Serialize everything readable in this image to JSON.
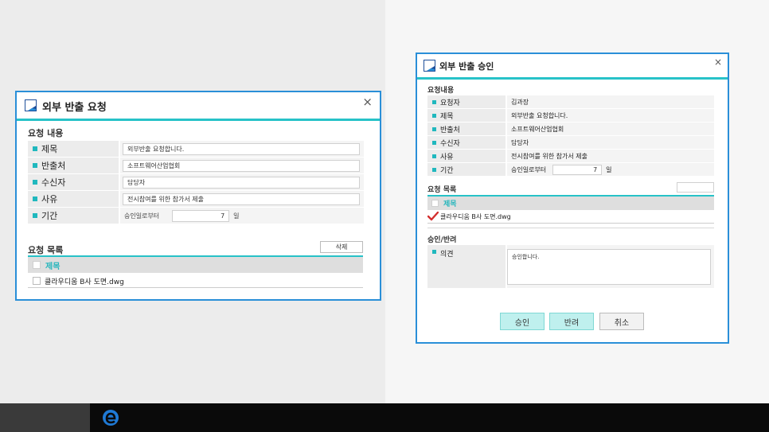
{
  "left": {
    "title": "외부 반출 요청",
    "close": "×",
    "section_info": "요청 내용",
    "fields": [
      {
        "label": "제목",
        "value": "외부반출 요청합니다."
      },
      {
        "label": "반출처",
        "value": "소프트웨어산업협회"
      },
      {
        "label": "수신자",
        "value": "담당자"
      },
      {
        "label": "사유",
        "value": "전시참여를 위한 참가서 제출"
      }
    ],
    "period": {
      "label": "기간",
      "prefix": "승인일로부터",
      "value": "7",
      "unit": "일"
    },
    "section_list": "요청 목록",
    "delete_label": "삭제",
    "list_header": "제목",
    "items": [
      "클라우디움 B사 도면.dwg"
    ]
  },
  "right": {
    "title": "외부 반출 승인",
    "close": "×",
    "section_info": "요청내용",
    "fields": [
      {
        "label": "요청자",
        "value": "김과장"
      },
      {
        "label": "제목",
        "value": "외부반출 요청합니다."
      },
      {
        "label": "반출처",
        "value": "소프트웨어산업협회"
      },
      {
        "label": "수신자",
        "value": "담당자"
      },
      {
        "label": "사유",
        "value": "전시참여를 위한 참가서 제출"
      }
    ],
    "period": {
      "label": "기간",
      "prefix": "승인일로부터",
      "value": "7",
      "unit": "일"
    },
    "section_list": "요청 목록",
    "list_header": "제목",
    "items": [
      "클라우디움 B사 도면.dwg"
    ],
    "section_approve": "승인/반려",
    "opinion_label": "의견",
    "opinion_text": "승인합니다.",
    "buttons": {
      "approve": "승인",
      "reject": "반려",
      "cancel": "취소"
    }
  },
  "colors": {
    "accent": "#27c2c8",
    "border": "#2a8fd8"
  }
}
